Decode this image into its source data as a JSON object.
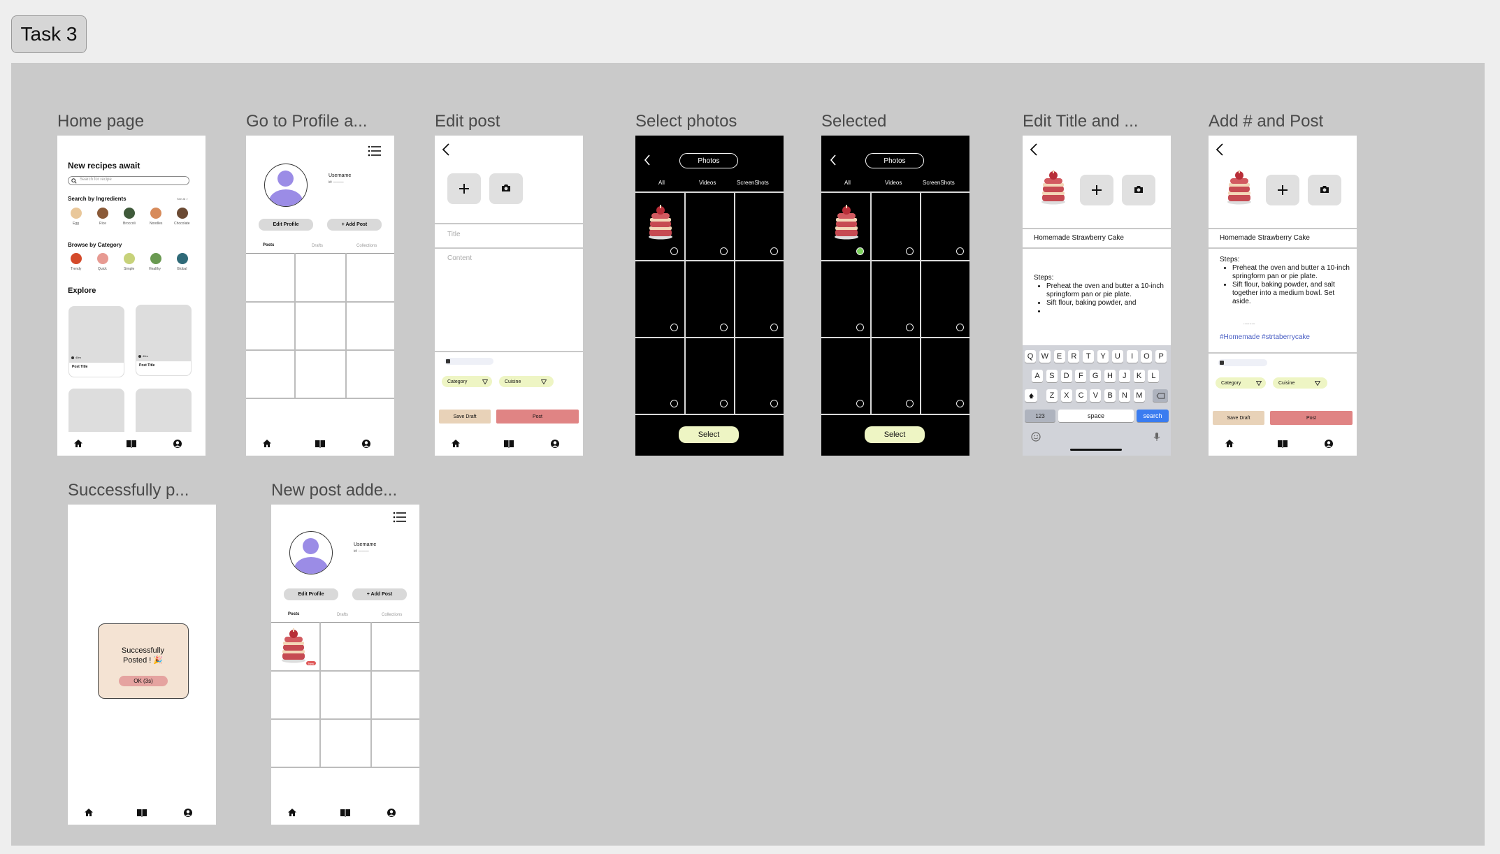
{
  "task_label": "Task 3",
  "frames": {
    "home": {
      "title": "Home page",
      "heading": "New recipes await",
      "search_placeholder": "Search for recipe",
      "ingredients_title": "Search by Ingredients",
      "see_all": "See all >",
      "ingredients": [
        "Egg",
        "Rice",
        "Broccoli",
        "Noodles",
        "Chocolate"
      ],
      "category_title": "Browse by Category",
      "categories": [
        "Trendy",
        "Quick",
        "Simple",
        "Healthy",
        "Global"
      ],
      "explore_title": "Explore",
      "post_title": "Post Title",
      "time": "40m"
    },
    "profile": {
      "title": "Go to Profile a...",
      "username": "Username",
      "user_id": "id: ———",
      "edit_profile": "Edit Profile",
      "add_post": "+ Add Post",
      "tabs": [
        "Posts",
        "Drafts",
        "Collections"
      ]
    },
    "edit": {
      "title": "Edit post",
      "title_placeholder": "Title",
      "content_placeholder": "Content",
      "category": "Category",
      "cuisine": "Cuisine",
      "save_draft": "Save Draft",
      "post": "Post"
    },
    "select": {
      "title": "Select photos",
      "photos": "Photos",
      "tabs": [
        "All",
        "Videos",
        "ScreenShots"
      ],
      "select_btn": "Select"
    },
    "selected": {
      "title": "Selected",
      "photos": "Photos",
      "tabs": [
        "All",
        "Videos",
        "ScreenShots"
      ],
      "select_btn": "Select"
    },
    "edit_title": {
      "title": "Edit Title and ...",
      "post_title": "Homemade Strawberry Cake",
      "steps_label": "Steps:",
      "steps": [
        "Preheat the oven and butter a 10-inch springform pan or pie plate.",
        "Sift flour, baking powder, and",
        ""
      ],
      "kb_row1": [
        "Q",
        "W",
        "E",
        "R",
        "T",
        "Y",
        "U",
        "I",
        "O",
        "P"
      ],
      "kb_row2": [
        "A",
        "S",
        "D",
        "F",
        "G",
        "H",
        "J",
        "K",
        "L"
      ],
      "kb_row3": [
        "Z",
        "X",
        "C",
        "V",
        "B",
        "N",
        "M"
      ],
      "kb_num": "123",
      "kb_space": "space",
      "kb_search": "search"
    },
    "add_tag": {
      "title": "Add # and Post",
      "post_title": "Homemade Strawberry Cake",
      "steps_label": "Steps:",
      "steps": [
        "Preheat the oven and butter a 10-inch springform pan or pie plate.",
        "Sift flour, baking powder, and salt together into a medium bowl. Set aside."
      ],
      "ellipsis": "..........",
      "hashtags": "#Homemade #strtaberrycake",
      "category": "Category",
      "cuisine": "Cuisine",
      "save_draft": "Save Draft",
      "post": "Post"
    },
    "success": {
      "title": "Successfully p...",
      "message_line1": "Successfully",
      "message_line2": "Posted ! 🎉",
      "ok": "OK (3s)"
    },
    "new_post": {
      "title": "New post adde...",
      "username": "Username",
      "user_id": "id: ———",
      "edit_profile": "Edit Profile",
      "add_post": "+ Add Post",
      "tabs": [
        "Posts",
        "Drafts",
        "Collections"
      ],
      "badge": "New"
    }
  },
  "colors": {
    "canvas": "#cacaca",
    "accent_purple": "#9b8ce6",
    "post_red": "#e08484",
    "save_tan": "#e8d2b8",
    "select_yellow": "#eef5c4",
    "keyboard_bg": "#d1d3d9",
    "search_blue": "#3a7cf0",
    "hashtag_blue": "#4a5fc4",
    "success_bg": "#f4e3d3",
    "green_dot": "#7bd15c"
  }
}
